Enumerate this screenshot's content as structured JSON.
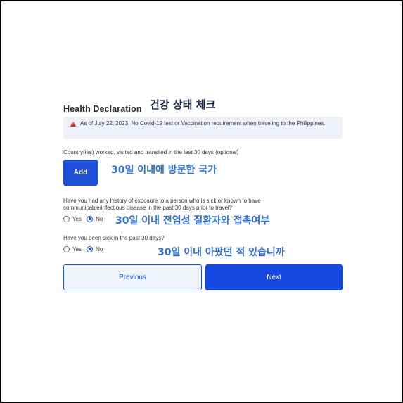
{
  "annotations": {
    "title_ko": "건강 상태 체크",
    "countries_ko": "30일 이내에 방문한 국가",
    "exposure_ko": "30일 이내 전염성 질환자와 접촉여부",
    "sick_ko": "30일 이내 아팠던 적 있습니까"
  },
  "form": {
    "title": "Health Declaration",
    "notice": {
      "icon": "warning-icon",
      "text": "As of July 22, 2023, No Covid-19 test or Vaccination requirement when traveling to the Philippines."
    },
    "countries": {
      "label": "Country(ies) worked, visited and transited in the last 30 days (optional)",
      "add_label": "Add"
    },
    "exposure": {
      "question": "Have you had any history of exposure to a person who is sick or known to have communicable/infectious disease in the past 30 days prior to travel?",
      "options": [
        "Yes",
        "No"
      ],
      "selected": "No"
    },
    "sick": {
      "question": "Have you been sick in the past 30 days?",
      "options": [
        "Yes",
        "No"
      ],
      "selected": "No"
    },
    "previous_label": "Previous",
    "next_label": "Next"
  },
  "colors": {
    "primary": "#1e4fd6",
    "annotation_blue": "#2f6fd6",
    "notice_bg": "#eef1fa",
    "warning": "#d32f2f"
  }
}
